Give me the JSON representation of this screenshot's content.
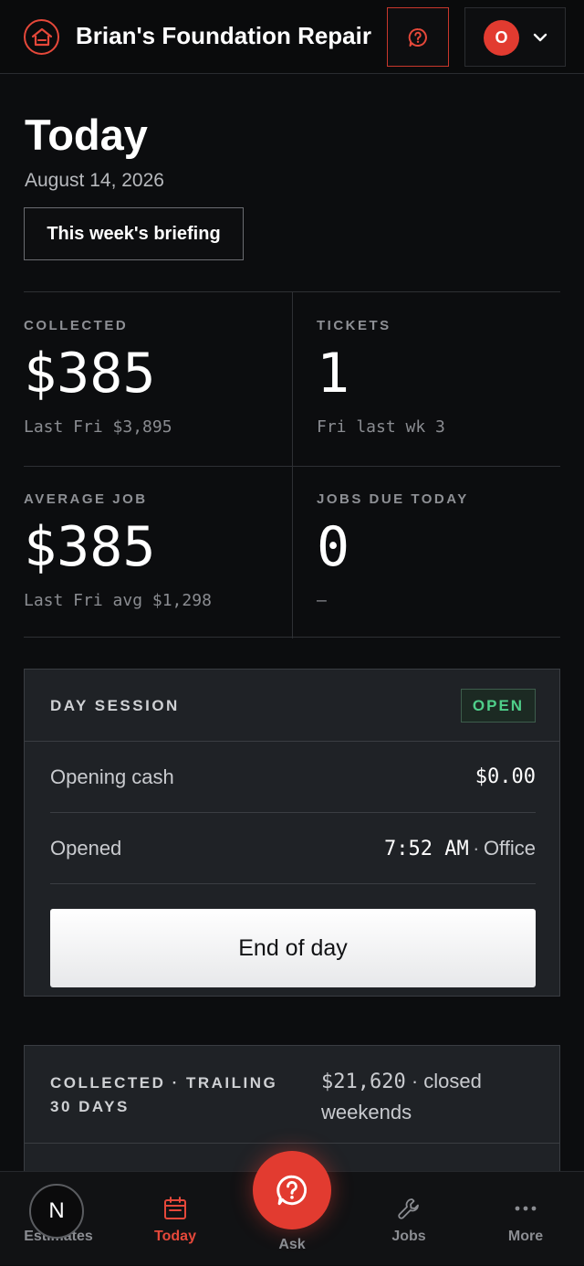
{
  "header": {
    "brand": "Brian's Foundation Repair",
    "account_initial": "O"
  },
  "today": {
    "title": "Today",
    "date": "August 14, 2026",
    "briefing_button": "This week's briefing"
  },
  "stats": [
    {
      "label": "COLLECTED",
      "value": "$385",
      "sub": "Last Fri $3,895"
    },
    {
      "label": "TICKETS",
      "value": "1",
      "sub": "Fri last wk 3"
    },
    {
      "label": "AVERAGE JOB",
      "value": "$385",
      "sub": "Last Fri avg $1,298"
    },
    {
      "label": "JOBS DUE TODAY",
      "value": "0",
      "sub": "—"
    }
  ],
  "session": {
    "title": "DAY SESSION",
    "status": "OPEN",
    "opening_cash_label": "Opening cash",
    "opening_cash_value": "$0.00",
    "opened_label": "Opened",
    "opened_time": "7:52 AM",
    "separator": "·",
    "opened_location": "Office",
    "end_button": "End of day"
  },
  "trailing": {
    "label": "COLLECTED · TRAILING 30 DAYS",
    "amount": "$21,620",
    "separator": "·",
    "note": "closed weekends"
  },
  "nav": {
    "avatar_initial": "N",
    "items": [
      {
        "label": "Estimates"
      },
      {
        "label": "Today"
      },
      {
        "label": "Ask"
      },
      {
        "label": "Jobs"
      },
      {
        "label": "More"
      }
    ]
  },
  "colors": {
    "accent": "#e23b30",
    "open_status": "#4fcf8a",
    "background": "#0c0d0f",
    "card": "#1f2226"
  },
  "icons": {
    "logo": "house-icon",
    "help": "help-bubble-icon",
    "account": "chevron-down-icon",
    "today": "calendar-icon",
    "ask": "question-bubble-icon",
    "jobs": "wrench-icon",
    "more": "dots-icon"
  }
}
